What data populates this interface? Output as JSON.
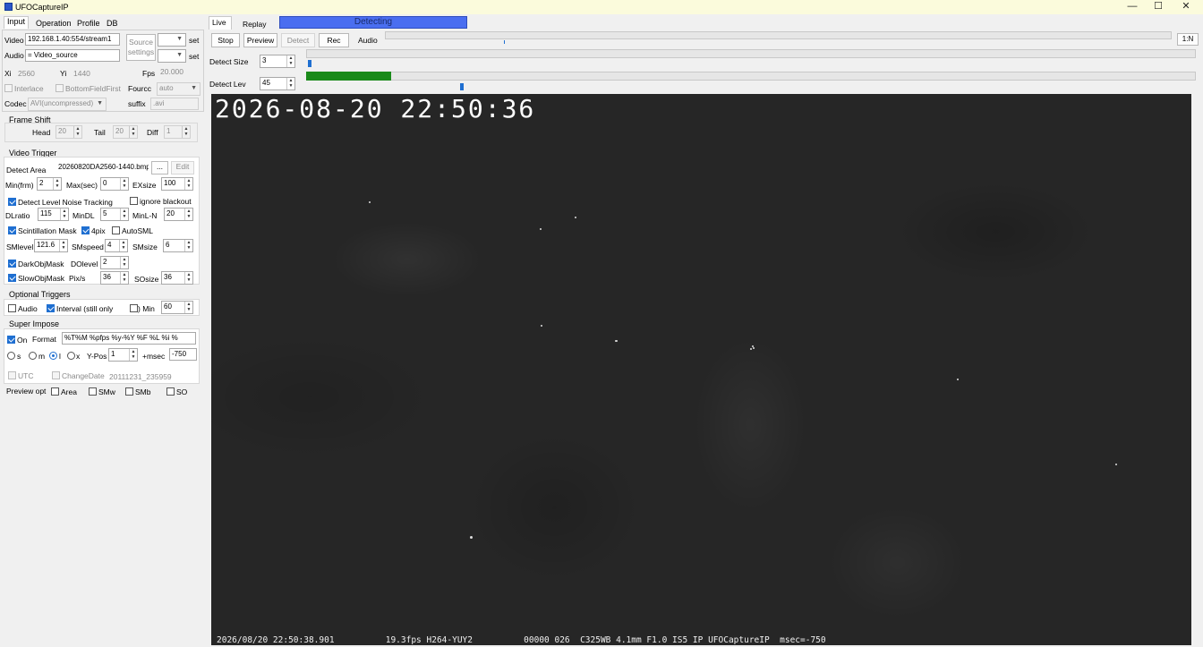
{
  "window": {
    "title": "UFOCaptureIP",
    "minimize": "—",
    "maximize": "☐",
    "close": "✕"
  },
  "tabs": [
    "Input",
    "Operation",
    "Profile",
    "DB"
  ],
  "input": {
    "video_label": "Video",
    "video_value": "192.168.1.40:554/stream1",
    "audio_label": "Audio",
    "audio_value": "= Video_source",
    "source_settings": "Source settings",
    "set1": "set",
    "set2": "set",
    "xi_label": "Xi",
    "xi_value": "2560",
    "yi_label": "Yi",
    "yi_value": "1440",
    "fps_label": "Fps",
    "fps_value": "20.000",
    "interlace": "Interlace",
    "bottom_field_first": "BottomFieldFirst",
    "fourcc_label": "Fourcc",
    "fourcc_value": "auto",
    "codec_label": "Codec",
    "codec_value": "AVI(uncompressed)",
    "suffix_label": "suffix",
    "suffix_value": ".avi"
  },
  "frame_shift": {
    "title": "Frame Shift",
    "head_label": "Head",
    "head_value": "20",
    "tail_label": "Tail",
    "tail_value": "20",
    "diff_label": "Diff",
    "diff_value": "1"
  },
  "video_trigger": {
    "title": "Video Trigger",
    "detect_area_label": "Detect Area",
    "detect_area_value": "20260820DA2560-1440.bmp",
    "browse": "...",
    "edit": "Edit",
    "min_frm_label": "Min(frm)",
    "min_frm_value": "2",
    "max_sec_label": "Max(sec)",
    "max_sec_value": "0",
    "exsize_label": "EXsize",
    "exsize_value": "100",
    "dlnt": "Detect Level Noise Tracking",
    "ignore_blackout": "ignore blackout",
    "dlratio_label": "DLratio",
    "dlratio_value": "115",
    "mindl_label": "MinDL",
    "mindl_value": "5",
    "minln_label": "MinL-N",
    "minln_value": "20",
    "scint_mask": "Scintillation Mask",
    "fourpix": "4pix",
    "autosml": "AutoSML",
    "smlevel_label": "SMlevel",
    "smlevel_value": "121.6",
    "smspeed_label": "SMspeed",
    "smspeed_value": "4",
    "smsize_label": "SMsize",
    "smsize_value": "6",
    "darkobj": "DarkObjMask",
    "dolevel_label": "DOlevel",
    "dolevel_value": "2",
    "slowobj": "SlowObjMask",
    "pixs_label": "Pix/s",
    "pixs_value": "36",
    "sosize_label": "SOsize",
    "sosize_value": "36"
  },
  "optional_triggers": {
    "title": "Optional Triggers",
    "audio": "Audio",
    "interval": "Interval (still only",
    "min_label": ") Min",
    "min_value": "60"
  },
  "super_impose": {
    "title": "Super Impose",
    "on": "On",
    "format_label": "Format",
    "format_value": "%T%M          %pfps %y-%Y %F %L  %i %",
    "s": "s",
    "m": "m",
    "l": "l",
    "x": "x",
    "ypos_label": "Y-Pos",
    "ypos_value": "1",
    "msec_label": "+msec",
    "msec_value": "-750",
    "utc": "UTC",
    "change_date": "ChangeDate",
    "change_date_value": "20111231_235959"
  },
  "preview_opt": {
    "label": "Preview opt",
    "area": "Area",
    "smw": "SMw",
    "smb": "SMb",
    "so": "SO"
  },
  "right": {
    "tab_live": "Live",
    "tab_replay": "Replay",
    "status": "Detecting",
    "stop": "Stop",
    "preview": "Preview",
    "detect": "Detect",
    "rec": "Rec",
    "audio": "Audio",
    "onen": "1:N",
    "detect_size_label": "Detect Size",
    "detect_size_value": "3",
    "detect_lev_label": "Detect Lev",
    "detect_lev_value": "45"
  },
  "meters": {
    "audio_level": 0.0,
    "detect_level_bar_fraction": 0.096
  },
  "overlay": {
    "timestamp": "2026-08-20  22:50:36",
    "bottom": "2026/08/20 22:50:38.901          19.3fps H264-YUY2          00000 026  C325WB 4.1mm F1.0 IS5 IP UFOCaptureIP  msec=-750"
  },
  "colors": {
    "status_blue": "#4a6ef0",
    "level_green": "#1a8a1a",
    "check_blue": "#1f6fd1",
    "titlebar": "#fbfbdc"
  }
}
